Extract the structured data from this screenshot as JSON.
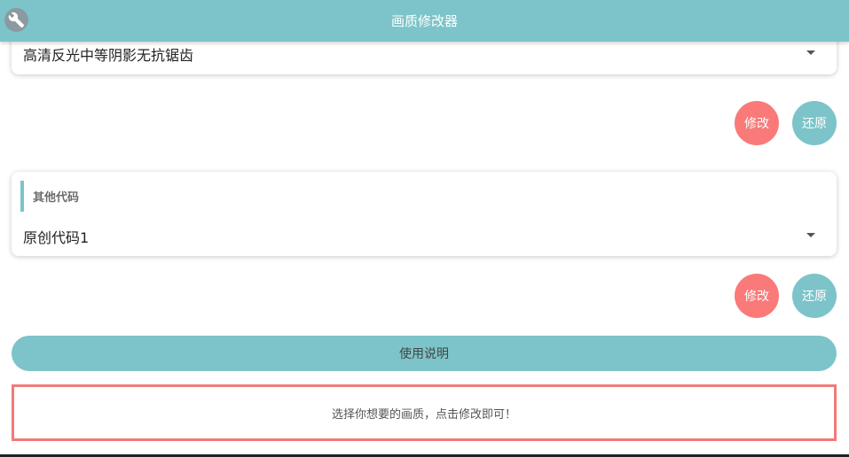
{
  "header": {
    "title": "画质修改器",
    "icon": "wrench-icon"
  },
  "quality_section": {
    "selected_value": "高清反光中等阴影无抗锯齿",
    "modify_label": "修改",
    "restore_label": "还原"
  },
  "other_code_section": {
    "label": "其他代码",
    "selected_value": "原创代码1",
    "modify_label": "修改",
    "restore_label": "还原"
  },
  "guide_button_label": "使用说明",
  "tip_text": "选择你想要的画质，点击修改即可！",
  "colors": {
    "primary": "#7cc4c9",
    "accent": "#f97a79",
    "tip_border": "#f07a7a"
  }
}
